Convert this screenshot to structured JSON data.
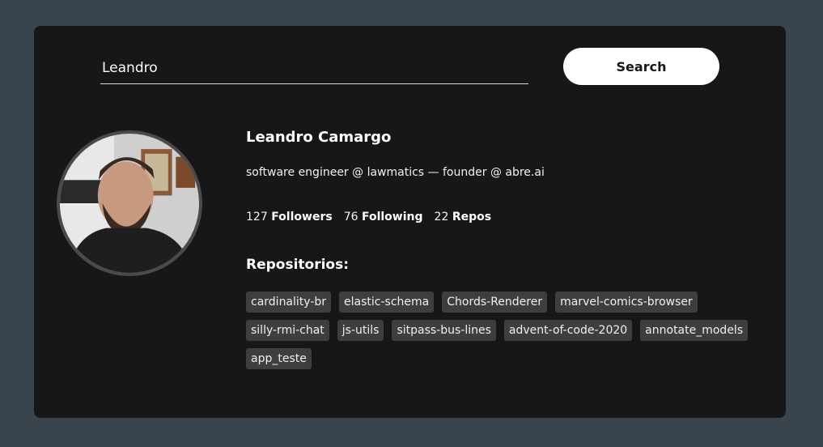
{
  "search": {
    "value": "Leandro",
    "button_label": "Search"
  },
  "profile": {
    "name": "Leandro Camargo",
    "bio": "software engineer @ lawmatics — founder @ abre.ai",
    "followers_count": "127",
    "followers_label": "Followers",
    "following_count": "76",
    "following_label": "Following",
    "repos_count": "22",
    "repos_label": "Repos"
  },
  "repositories": {
    "heading": "Repositorios:",
    "items": [
      "cardinality-br",
      "elastic-schema",
      "Chords-Renderer",
      "marvel-comics-browser",
      "silly-rmi-chat",
      "js-utils",
      "sitpass-bus-lines",
      "advent-of-code-2020",
      "annotate_models",
      "app_teste"
    ]
  }
}
